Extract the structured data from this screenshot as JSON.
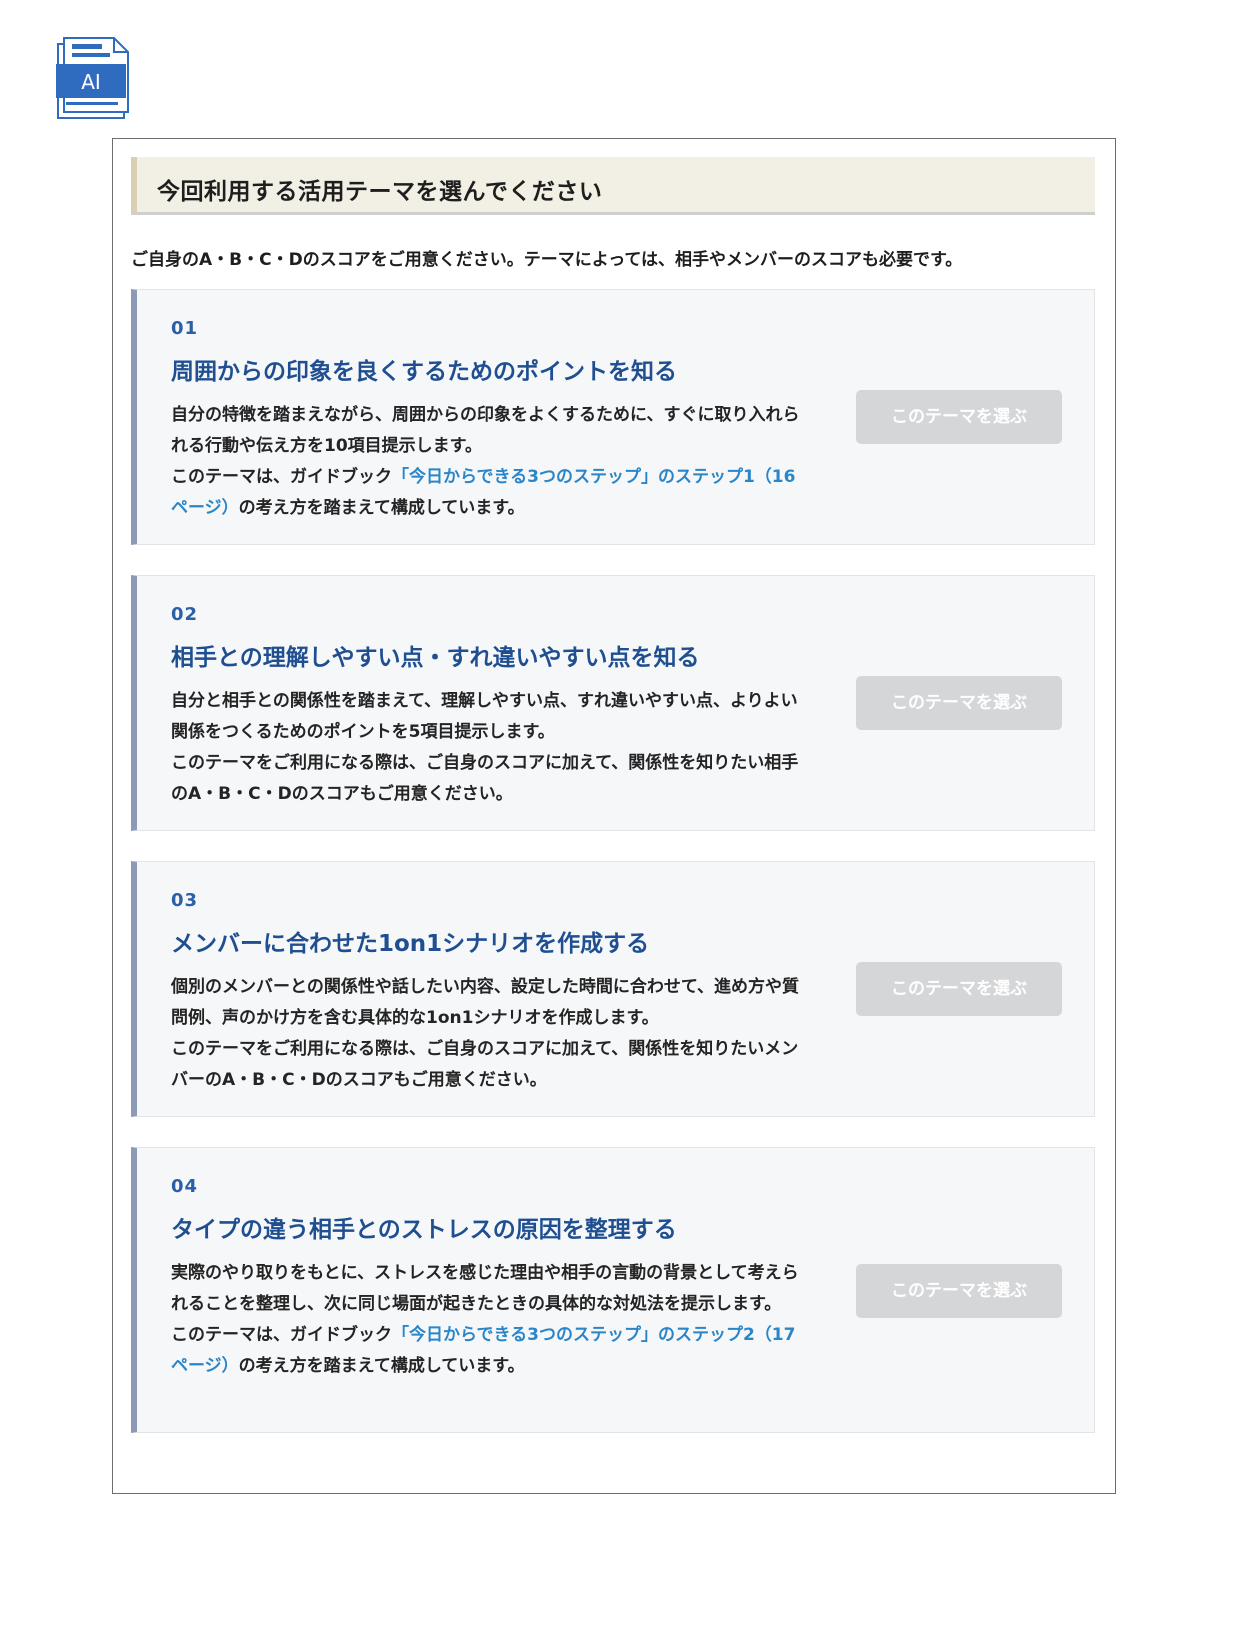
{
  "logo": {
    "text": "AI",
    "icon": "ai-document-icon",
    "color": "#2f6bbf"
  },
  "heading": "今回利用する活用テーマを選んでください",
  "intro": "ご自身のA・B・C・Dのスコアをご用意ください。テーマによっては、相手やメンバーのスコアも必要です。",
  "button_label": "このテーマを選ぶ",
  "themes": [
    {
      "num": "01",
      "title": "周囲からの印象を良くするためのポイントを知る",
      "desc1": "自分の特徴を踏まえながら、周囲からの印象をよくするために、すぐに取り入れられる行動や伝え方を10項目提示します。",
      "desc2_pre": "このテーマは、ガイドブック",
      "desc2_link": "「今日からできる3つのステップ」のステップ1（16ページ）",
      "desc2_post": "の考え方を踏まえて構成しています。"
    },
    {
      "num": "02",
      "title": "相手との理解しやすい点・すれ違いやすい点を知る",
      "desc1": "自分と相手との関係性を踏まえて、理解しやすい点、すれ違いやすい点、よりよい関係をつくるためのポイントを5項目提示します。",
      "desc2": "このテーマをご利用になる際は、ご自身のスコアに加えて、関係性を知りたい相手のA・B・C・Dのスコアもご用意ください。"
    },
    {
      "num": "03",
      "title": "メンバーに合わせた1on1シナリオを作成する",
      "desc1": "個別のメンバーとの関係性や話したい内容、設定した時間に合わせて、進め方や質問例、声のかけ方を含む具体的な1on1シナリオを作成します。",
      "desc2": "このテーマをご利用になる際は、ご自身のスコアに加えて、関係性を知りたいメンバーのA・B・C・Dのスコアもご用意ください。"
    },
    {
      "num": "04",
      "title": "タイプの違う相手とのストレスの原因を整理する",
      "desc1": "実際のやり取りをもとに、ストレスを感じた理由や相手の言動の背景として考えられることを整理し、次に同じ場面が起きたときの具体的な対処法を提示します。",
      "desc2_pre": "このテーマは、ガイドブック",
      "desc2_link": "「今日からできる3つのステップ」のステップ2（17ページ）",
      "desc2_post": "の考え方を踏まえて構成しています。"
    }
  ]
}
